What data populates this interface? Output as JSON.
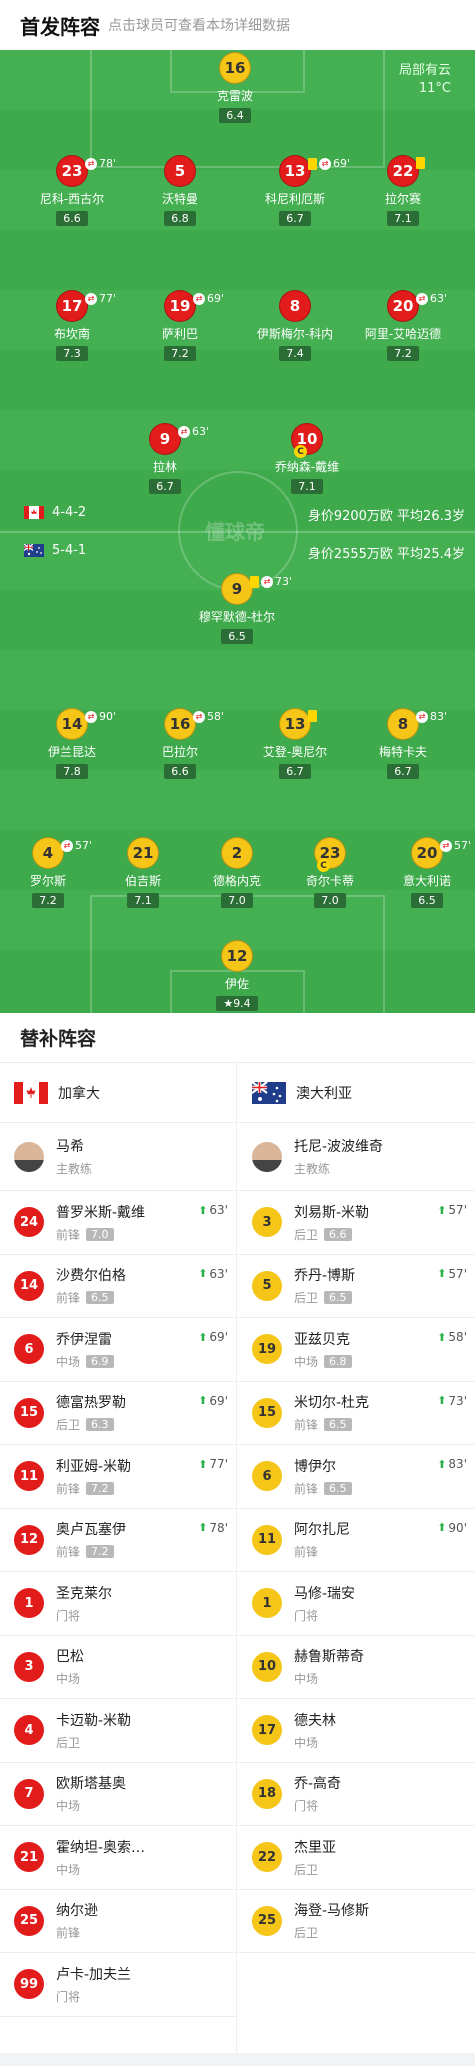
{
  "header": {
    "title": "首发阵容",
    "subtitle": "点击球员可查看本场详细数据"
  },
  "weather": {
    "condition": "局部有云",
    "temp": "11°C"
  },
  "watermark": "懂球帝",
  "home": {
    "formation": "4-4-2",
    "stat": "身价9200万欧 平均26.3岁"
  },
  "away": {
    "formation": "5-4-1",
    "stat": "身价2555万欧 平均25.4岁"
  },
  "pitch_players": [
    {
      "num": "16",
      "name": "克雷波",
      "rating": "6.4",
      "team": "yellow"
    },
    {
      "num": "23",
      "name": "尼科-西古尔",
      "rating": "6.6",
      "team": "red",
      "sub": "78'"
    },
    {
      "num": "5",
      "name": "沃特曼",
      "rating": "6.8",
      "team": "red"
    },
    {
      "num": "13",
      "name": "科尼利厄斯",
      "rating": "6.7",
      "team": "red",
      "sub": "69'",
      "card": true
    },
    {
      "num": "22",
      "name": "拉尔赛",
      "rating": "7.1",
      "team": "red",
      "card": true
    },
    {
      "num": "17",
      "name": "布坎南",
      "rating": "7.3",
      "team": "red",
      "sub": "77'"
    },
    {
      "num": "19",
      "name": "萨利巴",
      "rating": "7.2",
      "team": "red",
      "sub": "69'"
    },
    {
      "num": "8",
      "name": "伊斯梅尔-科内",
      "rating": "7.4",
      "team": "red"
    },
    {
      "num": "20",
      "name": "阿里-艾哈迈德",
      "rating": "7.2",
      "team": "red",
      "sub": "63'"
    },
    {
      "num": "9",
      "name": "拉林",
      "rating": "6.7",
      "team": "red",
      "sub": "63'"
    },
    {
      "num": "10",
      "name": "乔纳森-戴维",
      "rating": "7.1",
      "team": "red",
      "captain": "C"
    },
    {
      "num": "9",
      "name": "穆罕默德-杜尔",
      "rating": "6.5",
      "team": "yellow",
      "sub": "73'",
      "card": true
    },
    {
      "num": "14",
      "name": "伊兰昆达",
      "rating": "7.8",
      "team": "yellow",
      "sub": "90'"
    },
    {
      "num": "16",
      "name": "巴拉尔",
      "rating": "6.6",
      "team": "yellow",
      "sub": "58'"
    },
    {
      "num": "13",
      "name": "艾登-奥尼尔",
      "rating": "6.7",
      "team": "yellow",
      "card": true
    },
    {
      "num": "8",
      "name": "梅特卡夫",
      "rating": "6.7",
      "team": "yellow",
      "sub": "83'"
    },
    {
      "num": "4",
      "name": "罗尔斯",
      "rating": "7.2",
      "team": "yellow",
      "sub": "57'"
    },
    {
      "num": "21",
      "name": "伯吉斯",
      "rating": "7.1",
      "team": "yellow"
    },
    {
      "num": "2",
      "name": "德格内克",
      "rating": "7.0",
      "team": "yellow"
    },
    {
      "num": "23",
      "name": "奇尔卡蒂",
      "rating": "7.0",
      "team": "yellow",
      "captain": "C"
    },
    {
      "num": "20",
      "name": "意大利诺",
      "rating": "6.5",
      "team": "yellow",
      "sub": "57'"
    },
    {
      "num": "12",
      "name": "伊佐",
      "rating": "9.4",
      "team": "yellow",
      "star": "★"
    }
  ],
  "subs": {
    "title": "替补阵容",
    "left": {
      "team": "加拿大",
      "coach": {
        "name": "马希",
        "role": "主教练"
      },
      "players": [
        {
          "num": "24",
          "name": "普罗米斯-戴维",
          "pos": "前锋",
          "rating": "7.0",
          "in": "63'"
        },
        {
          "num": "14",
          "name": "沙费尔伯格",
          "pos": "前锋",
          "rating": "6.5",
          "in": "63'"
        },
        {
          "num": "6",
          "name": "乔伊涅雷",
          "pos": "中场",
          "rating": "6.9",
          "in": "69'"
        },
        {
          "num": "15",
          "name": "德富热罗勒",
          "pos": "后卫",
          "rating": "6.3",
          "in": "69'"
        },
        {
          "num": "11",
          "name": "利亚姆-米勒",
          "pos": "前锋",
          "rating": "7.2",
          "in": "77'"
        },
        {
          "num": "12",
          "name": "奥卢瓦塞伊",
          "pos": "前锋",
          "rating": "7.2",
          "in": "78'"
        },
        {
          "num": "1",
          "name": "圣克莱尔",
          "pos": "门将"
        },
        {
          "num": "3",
          "name": "巴松",
          "pos": "中场"
        },
        {
          "num": "4",
          "name": "卡迈勒-米勒",
          "pos": "后卫"
        },
        {
          "num": "7",
          "name": "欧斯塔基奥",
          "pos": "中场"
        },
        {
          "num": "21",
          "name": "霍纳坦-奥索…",
          "pos": "中场"
        },
        {
          "num": "25",
          "name": "纳尔逊",
          "pos": "前锋"
        },
        {
          "num": "99",
          "name": "卢卡-加夫兰",
          "pos": "门将"
        }
      ]
    },
    "right": {
      "team": "澳大利亚",
      "coach": {
        "name": "托尼-波波维奇",
        "role": "主教练"
      },
      "players": [
        {
          "num": "3",
          "name": "刘易斯-米勒",
          "pos": "后卫",
          "rating": "6.6",
          "in": "57'"
        },
        {
          "num": "5",
          "name": "乔丹-博斯",
          "pos": "后卫",
          "rating": "6.5",
          "in": "57'"
        },
        {
          "num": "19",
          "name": "亚兹贝克",
          "pos": "中场",
          "rating": "6.8",
          "in": "58'"
        },
        {
          "num": "15",
          "name": "米切尔-杜克",
          "pos": "前锋",
          "rating": "6.5",
          "in": "73'"
        },
        {
          "num": "6",
          "name": "博伊尔",
          "pos": "前锋",
          "rating": "6.5",
          "in": "83'"
        },
        {
          "num": "11",
          "name": "阿尔扎尼",
          "pos": "前锋",
          "in": "90'"
        },
        {
          "num": "1",
          "name": "马修-瑞安",
          "pos": "门将"
        },
        {
          "num": "10",
          "name": "赫鲁斯蒂奇",
          "pos": "中场"
        },
        {
          "num": "17",
          "name": "德夫林",
          "pos": "中场"
        },
        {
          "num": "18",
          "name": "乔-高奇",
          "pos": "门将"
        },
        {
          "num": "22",
          "name": "杰里亚",
          "pos": "后卫"
        },
        {
          "num": "25",
          "name": "海登-马修斯",
          "pos": "后卫"
        }
      ]
    }
  },
  "colors": {
    "pitch": "#3eaa4c",
    "home": "#e21b1b",
    "away": "#f5c518",
    "sub_arrow": "#2cb04a"
  }
}
